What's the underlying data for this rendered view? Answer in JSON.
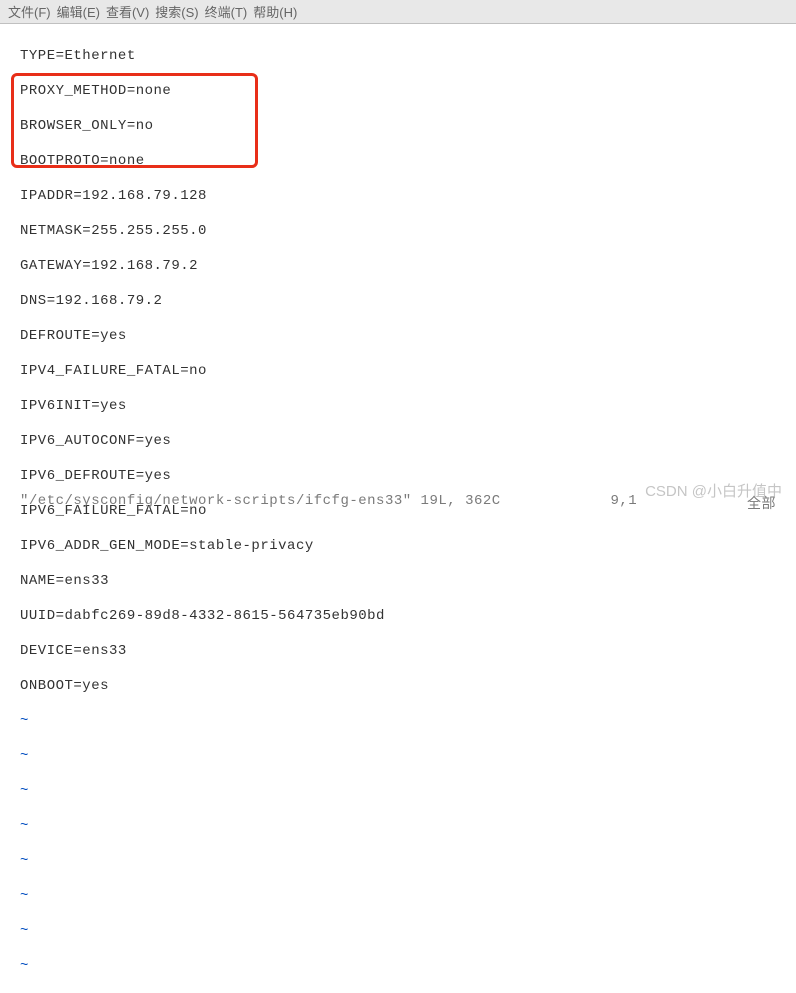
{
  "menu": {
    "file": "文件(F)",
    "edit": "编辑(E)",
    "view": "查看(V)",
    "search": "搜索(S)",
    "terminal": "终端(T)",
    "help": "帮助(H)"
  },
  "config_lines": [
    "TYPE=Ethernet",
    "PROXY_METHOD=none",
    "BROWSER_ONLY=no",
    "BOOTPROTO=none",
    "IPADDR=192.168.79.128",
    "NETMASK=255.255.255.0",
    "GATEWAY=192.168.79.2",
    "DNS=192.168.79.2",
    "DEFROUTE=yes",
    "IPV4_FAILURE_FATAL=no",
    "IPV6INIT=yes",
    "IPV6_AUTOCONF=yes",
    "IPV6_DEFROUTE=yes",
    "IPV6_FAILURE_FATAL=no",
    "IPV6_ADDR_GEN_MODE=stable-privacy",
    "NAME=ens33",
    "UUID=dabfc269-89d8-4332-8615-564735eb90bd",
    "DEVICE=ens33",
    "ONBOOT=yes"
  ],
  "empty_marker": "~",
  "status": {
    "left": "\"/etc/sysconfig/network-scripts/ifcfg-ens33\" 19L, 362C",
    "pos": "9,1",
    "right": "全部"
  },
  "watermark": "CSDN @小白升值中"
}
